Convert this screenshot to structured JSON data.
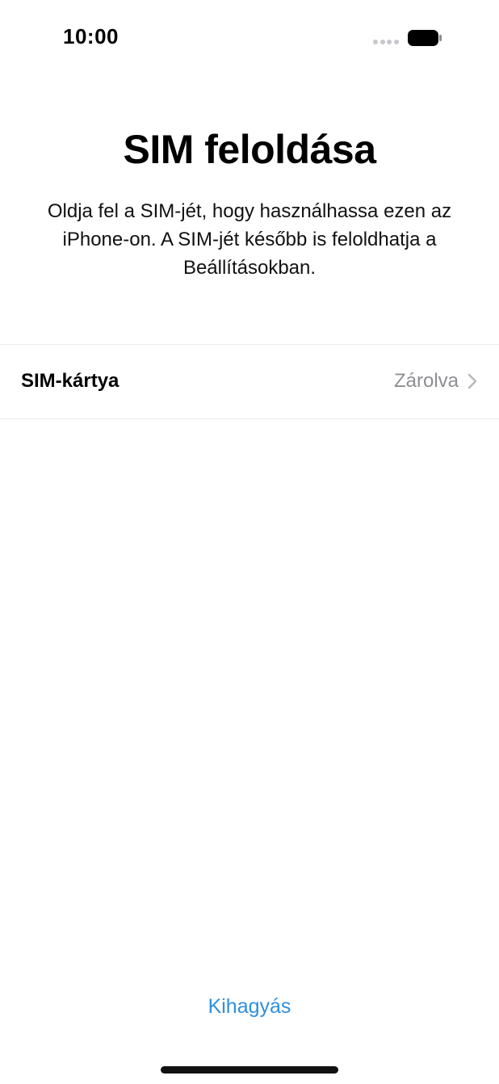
{
  "status_bar": {
    "time": "10:00",
    "signal_icon": "cellular-no-signal-dots",
    "battery_icon": "battery-full-icon"
  },
  "page": {
    "title": "SIM feloldása",
    "description": "Oldja fel a SIM-jét, hogy használhassa ezen az iPhone-on. A SIM-jét később is feloldhatja a Beállításokban."
  },
  "sim_row": {
    "label": "SIM-kártya",
    "status": "Zárolva",
    "icon": "chevron-right-icon"
  },
  "footer": {
    "skip_label": "Kihagyás"
  },
  "colors": {
    "accent": "#2f8fdc",
    "secondary_text": "#8e8e93",
    "separator": "#ececec"
  }
}
